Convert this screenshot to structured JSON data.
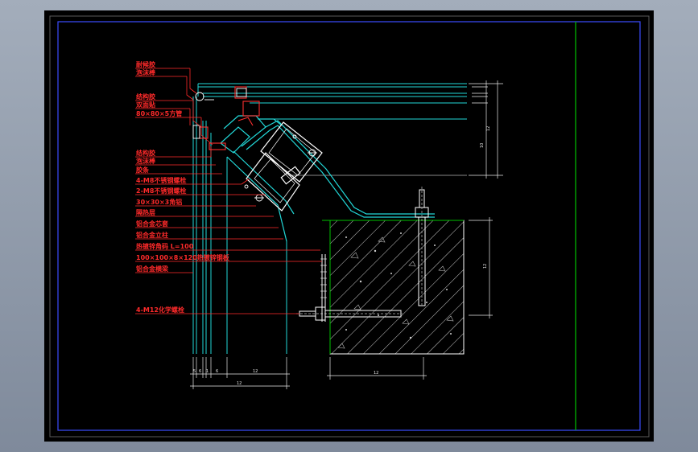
{
  "drawing": {
    "colors": {
      "background": "#000000",
      "frame": "#4a5cff",
      "annotation": "#ff2a2a",
      "profile": "#22d8d8",
      "concrete": "#ffffff",
      "steel": "#ffffff",
      "gasket": "#ff3030",
      "guide": "#00c000"
    },
    "labels": [
      "耐候胶",
      "泡沫棒",
      "结构胶",
      "双面贴",
      "80×80×5方管",
      "结构胶",
      "泡沫棒",
      "胶条",
      "4-M8不锈钢螺栓",
      "2-M8不锈钢螺栓",
      "30×30×3角铝",
      "隔热层",
      "铝合金芯套",
      "铝合金立柱",
      "热镀锌角码 L=100",
      "100×100×8×120热镀锌钢板",
      "铝合金横梁",
      "4-M12化学螺栓"
    ],
    "dimensions": {
      "right_top": "12",
      "right_mid": "10",
      "right_bottom": "12",
      "bottom_small": [
        "5",
        "6",
        "1",
        "6"
      ],
      "bottom_profile": "12",
      "bottom_total": "12",
      "bottom_anchor": "12"
    }
  }
}
